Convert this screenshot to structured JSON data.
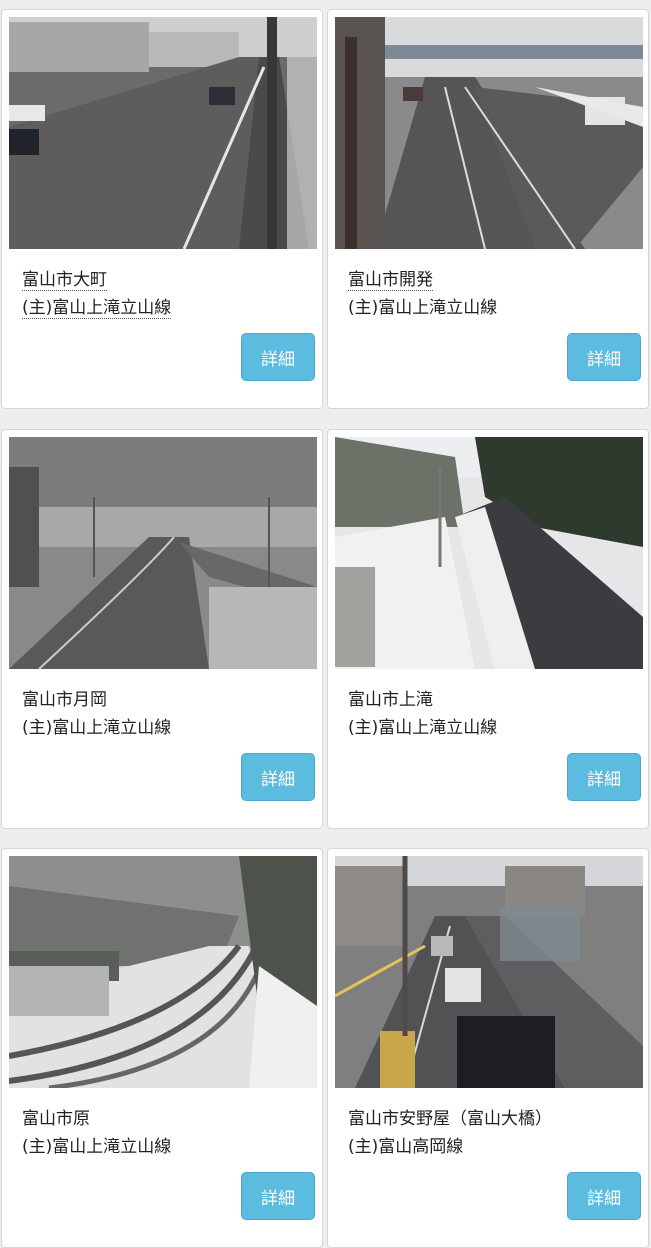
{
  "cameras": [
    {
      "location": "富山市大町",
      "route": "(主)富山上滝立山線",
      "detail_label": "詳細",
      "image": "camera-photo-rainy-urban-road"
    },
    {
      "location": "富山市開発",
      "route": "(主)富山上滝立山線",
      "detail_label": "詳細",
      "image": "camera-photo-snowy-overpass-road"
    },
    {
      "location": "富山市月岡",
      "route": "(主)富山上滝立山線",
      "detail_label": "詳細",
      "image": "camera-photo-foggy-curved-road"
    },
    {
      "location": "富山市上滝",
      "route": "(主)富山上滝立山線",
      "detail_label": "詳細",
      "image": "camera-photo-snowy-forest-road"
    },
    {
      "location": "富山市原",
      "route": "(主)富山上滝立山線",
      "detail_label": "詳細",
      "image": "camera-photo-snow-covered-hill-road"
    },
    {
      "location": "富山市安野屋（富山大橋）",
      "route": "(主)富山高岡線",
      "detail_label": "詳細",
      "image": "camera-photo-city-street-with-cars"
    }
  ],
  "colors": {
    "button": "#5bbce0",
    "background": "#eeeeee",
    "card": "#ffffff"
  }
}
